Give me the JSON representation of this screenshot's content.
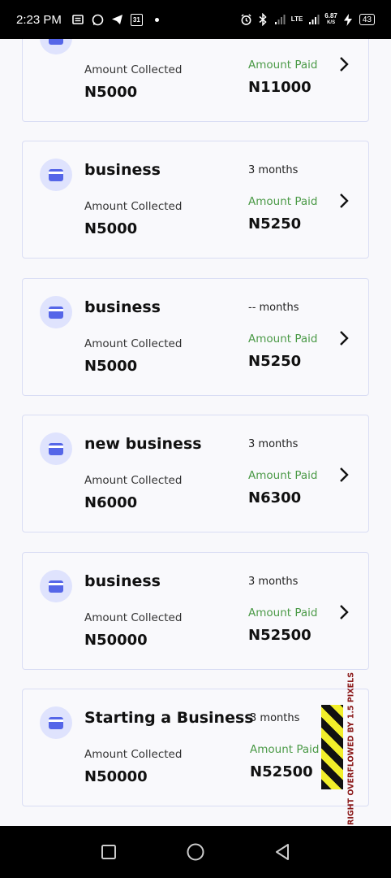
{
  "status_bar": {
    "time": "2:23 PM",
    "calendar_day": "31",
    "network": "LTE",
    "speed_value": "6.87",
    "speed_unit": "K/S",
    "battery": "43"
  },
  "cards": [
    {
      "title": "",
      "months": "",
      "collected_label": "Amount Collected",
      "collected_amount": "N5000",
      "paid_label": "Amount Paid",
      "paid_amount": "N11000"
    },
    {
      "title": "business",
      "months": "3 months",
      "collected_label": "Amount Collected",
      "collected_amount": "N5000",
      "paid_label": "Amount Paid",
      "paid_amount": "N5250"
    },
    {
      "title": "business",
      "months": "-- months",
      "collected_label": "Amount Collected",
      "collected_amount": "N5000",
      "paid_label": "Amount Paid",
      "paid_amount": "N5250"
    },
    {
      "title": "new business",
      "months": "3 months",
      "collected_label": "Amount Collected",
      "collected_amount": "N6000",
      "paid_label": "Amount Paid",
      "paid_amount": "N6300"
    },
    {
      "title": "business",
      "months": "3 months",
      "collected_label": "Amount Collected",
      "collected_amount": "N50000",
      "paid_label": "Amount Paid",
      "paid_amount": "N52500"
    },
    {
      "title": "Starting a Business",
      "months": "3 months",
      "collected_label": "Amount Collected",
      "collected_amount": "N50000",
      "paid_label": "Amount Paid",
      "paid_amount": "N52500",
      "overflow_warning": "RIGHT OVERFLOWED BY 1.5 PIXELS"
    }
  ],
  "colors": {
    "accent": "#5566e8",
    "paid_label": "#4b9a47",
    "card_border": "#d9ddf4",
    "avatar_bg": "#dfe3fd"
  },
  "icons": {
    "card_avatar": "wallet-icon",
    "row_action": "chevron-right-icon",
    "nav": [
      "recent-apps-icon",
      "home-icon",
      "back-icon"
    ]
  }
}
